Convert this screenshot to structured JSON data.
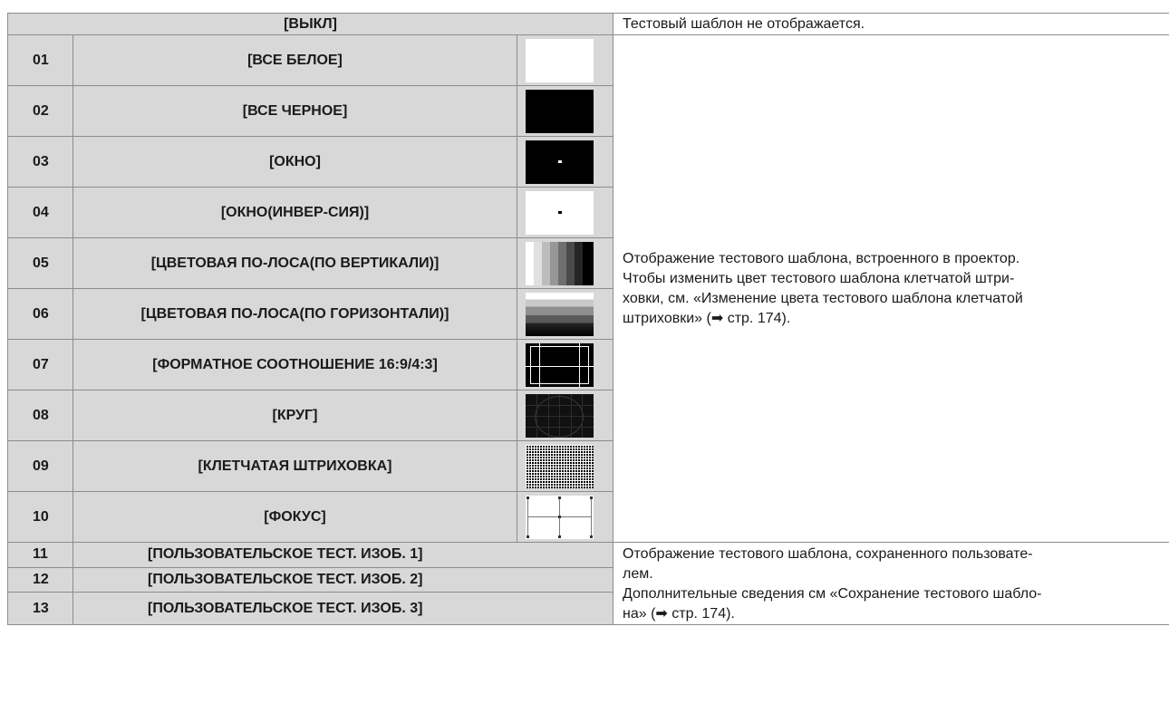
{
  "header": {
    "off_label": "[ВЫКЛ]",
    "off_desc": "Тестовый шаблон не отображается."
  },
  "rows": [
    {
      "num": "01",
      "name": "[ВСЕ БЕЛОЕ]",
      "thumb": "all-white-pattern"
    },
    {
      "num": "02",
      "name": "[ВСЕ ЧЕРНОЕ]",
      "thumb": "all-black-pattern"
    },
    {
      "num": "03",
      "name": "[ОКНО]",
      "thumb": "window-pattern"
    },
    {
      "num": "04",
      "name": "[ОКНО(ИНВЕР-СИЯ)]",
      "thumb": "window-inverse-pattern"
    },
    {
      "num": "05",
      "name": "[ЦВЕТОВАЯ ПО-ЛОСА(ПО ВЕРТИКАЛИ)]",
      "thumb": "vertical-color-bar-pattern"
    },
    {
      "num": "06",
      "name": "[ЦВЕТОВАЯ ПО-ЛОСА(ПО ГОРИЗОНТАЛИ)]",
      "thumb": "horizontal-color-bar-pattern"
    },
    {
      "num": "07",
      "name": "[ФОРМАТНОЕ СООТНОШЕНИЕ 16:9/4:3]",
      "thumb": "aspect-frame-pattern"
    },
    {
      "num": "08",
      "name": "[КРУГ]",
      "thumb": "circle-pattern"
    },
    {
      "num": "09",
      "name": "[КЛЕТЧАТАЯ ШТРИХОВКА]",
      "thumb": "cross-hatch-pattern"
    },
    {
      "num": "10",
      "name": "[ФОКУС]",
      "thumb": "focus-pattern"
    }
  ],
  "builtin_desc": [
    "Отображение тестового шаблона, встроенного в проектор.",
    "Чтобы изменить цвет тестового шаблона клетчатой штри-",
    "ховки, см. «Изменение цвета тестового шаблона клетчатой",
    "штриховки» (➡ стр. 174)."
  ],
  "user_rows": [
    {
      "num": "11",
      "name": "[ПОЛЬЗОВАТЕЛЬСКОЕ ТЕСТ. ИЗОБ. 1]"
    },
    {
      "num": "12",
      "name": "[ПОЛЬЗОВАТЕЛЬСКОЕ ТЕСТ. ИЗОБ. 2]"
    },
    {
      "num": "13",
      "name": "[ПОЛЬЗОВАТЕЛЬСКОЕ ТЕСТ. ИЗОБ. 3]"
    }
  ],
  "user_desc": [
    "Отображение тестового шаблона, сохраненного пользовате-",
    "лем.",
    "Дополнительные сведения см «Сохранение тестового шабло-",
    "на» (➡ стр. 174)."
  ]
}
